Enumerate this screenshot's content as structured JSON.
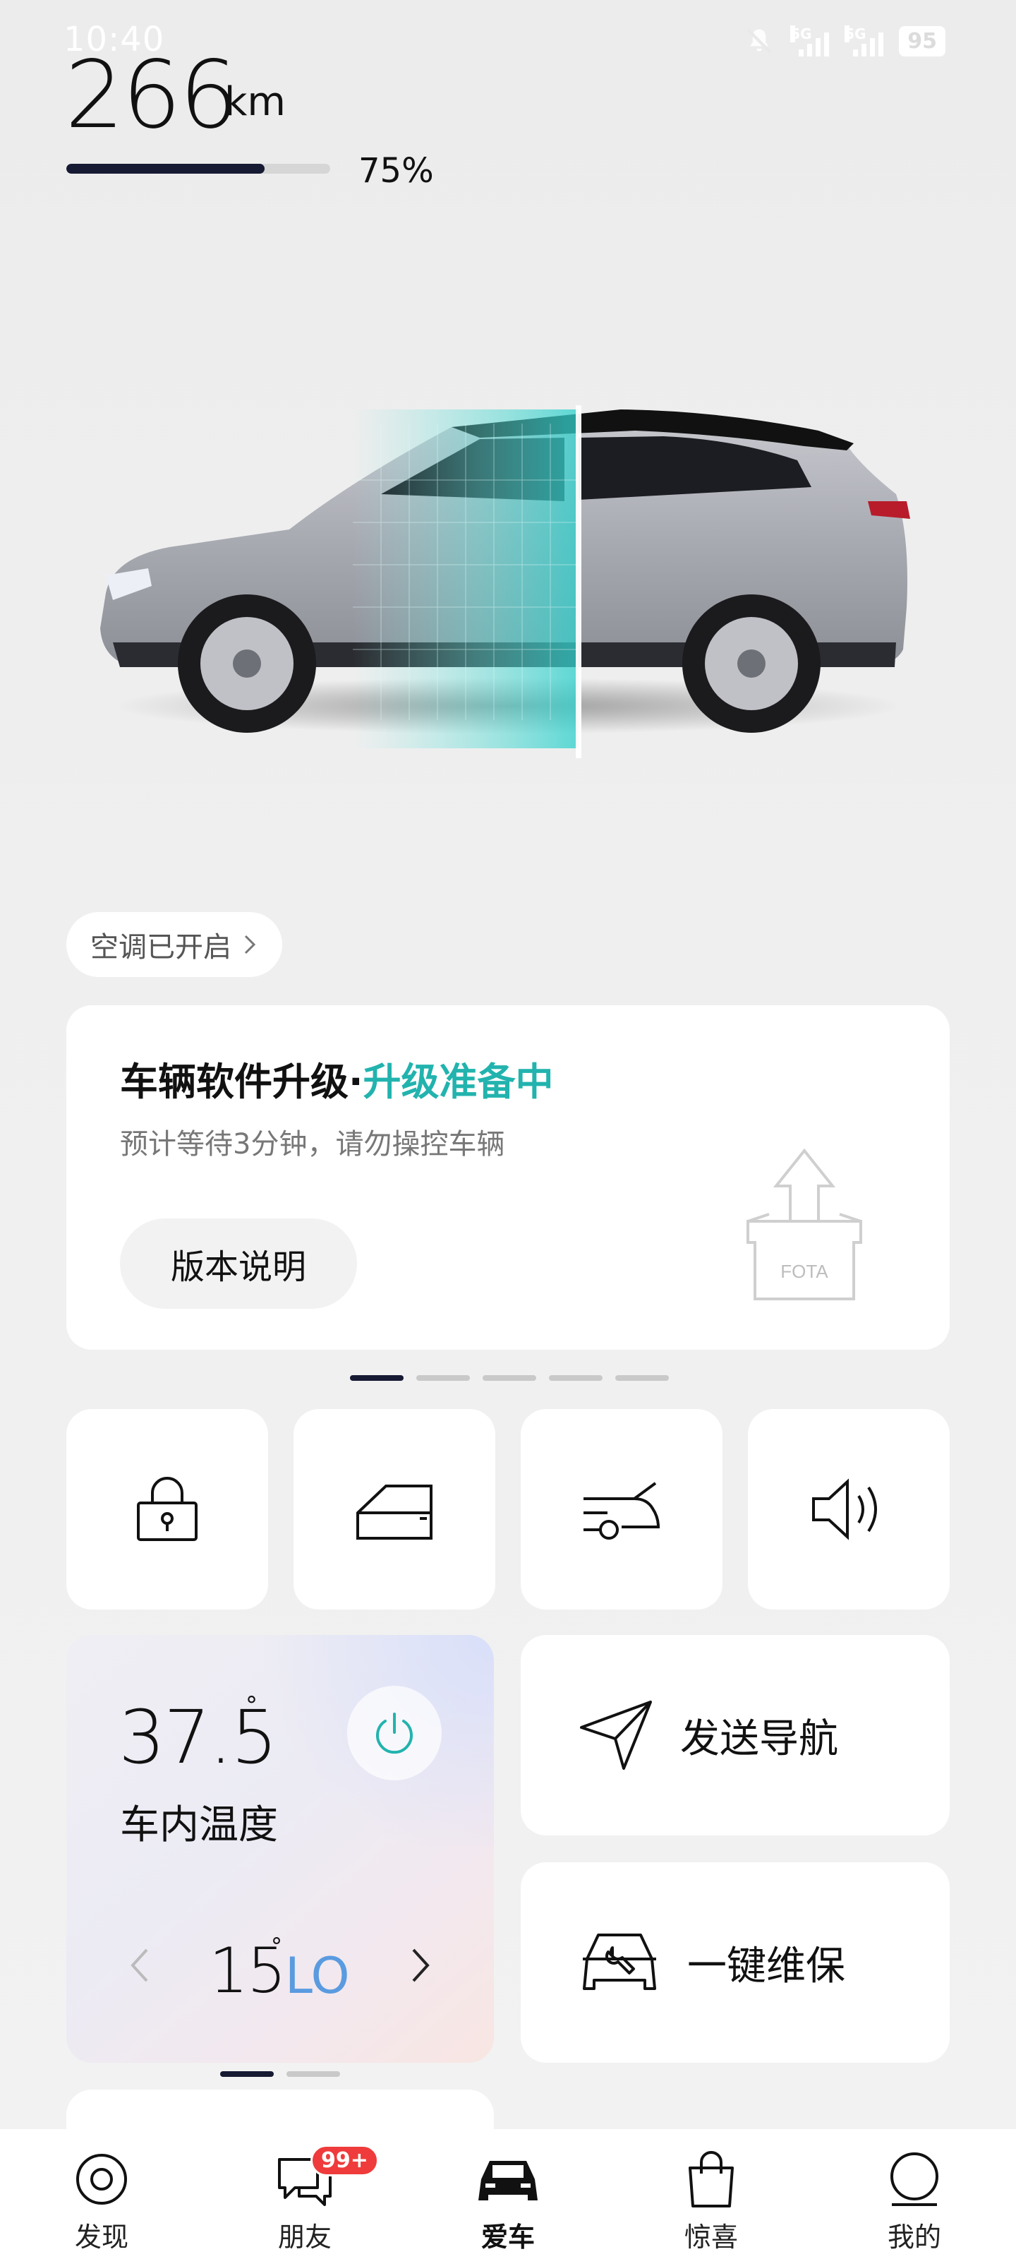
{
  "status_bar": {
    "time": "10:40",
    "network_1": "5G",
    "network_2": "5G",
    "battery": "95",
    "icons": [
      "mute-icon",
      "signal-icon",
      "signal-icon",
      "battery-icon"
    ]
  },
  "range": {
    "value": "266",
    "unit": "km",
    "battery_percent_label": "75%",
    "battery_fraction": 0.75
  },
  "ac_status": {
    "label": "空调已开启",
    "icon": "chevron-right-icon"
  },
  "upgrade_card": {
    "title": "车辆软件升级",
    "separator": "·",
    "status": "升级准备中",
    "subtitle": "预计等待3分钟，请勿操控车辆",
    "button": "版本说明",
    "icon_text": "FOTA",
    "accent_color": "#22b3ae"
  },
  "pager_top": {
    "count": 5,
    "active": 0
  },
  "quick_controls": [
    {
      "name": "lock",
      "icon": "lock-icon"
    },
    {
      "name": "window",
      "icon": "car-window-icon"
    },
    {
      "name": "trunk",
      "icon": "trunk-icon"
    },
    {
      "name": "horn",
      "icon": "speaker-icon"
    }
  ],
  "climate": {
    "cabin_temp": "37.5",
    "cabin_temp_unit": "°",
    "label": "车内温度",
    "set_temp": "15",
    "set_temp_unit": "°",
    "set_mode": "LO",
    "prev_icon": "chevron-left-icon",
    "next_icon": "chevron-right-icon",
    "power_icon": "power-icon",
    "power_color": "#22b3ae"
  },
  "pager_bottom": {
    "count": 2,
    "active": 0
  },
  "actions": {
    "navigation": {
      "label": "发送导航",
      "icon": "send-navigation-icon"
    },
    "maintenance": {
      "label": "一键维保",
      "icon": "car-maintenance-icon"
    }
  },
  "tab_bar": {
    "tabs": [
      {
        "label": "发现",
        "icon": "discover-icon"
      },
      {
        "label": "朋友",
        "icon": "chat-icon",
        "badge": "99+"
      },
      {
        "label": "爱车",
        "icon": "car-icon",
        "active": true
      },
      {
        "label": "惊喜",
        "icon": "shopping-bag-icon"
      },
      {
        "label": "我的",
        "icon": "profile-icon"
      }
    ]
  }
}
